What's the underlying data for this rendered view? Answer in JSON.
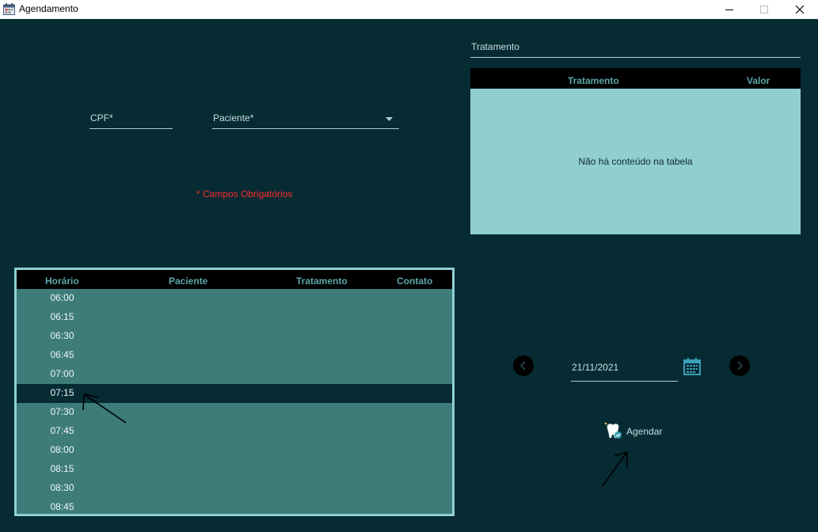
{
  "window": {
    "title": "Agendamento"
  },
  "form": {
    "cpf_label": "CPF*",
    "paciente_label": "Paciente*",
    "required_note": "* Campos Obrigatórios"
  },
  "treatment": {
    "field_label": "Tratamento",
    "columns": [
      "Tratamento",
      "Valor"
    ],
    "empty_message": "Não há conteúdo na tabela"
  },
  "schedule": {
    "columns": [
      "Horário",
      "Paciente",
      "Tratamento",
      "Contato"
    ],
    "rows": [
      {
        "time": "06:00",
        "selected": false
      },
      {
        "time": "06:15",
        "selected": false
      },
      {
        "time": "06:30",
        "selected": false
      },
      {
        "time": "06:45",
        "selected": false
      },
      {
        "time": "07:00",
        "selected": false
      },
      {
        "time": "07:15",
        "selected": true
      },
      {
        "time": "07:30",
        "selected": false
      },
      {
        "time": "07:45",
        "selected": false
      },
      {
        "time": "08:00",
        "selected": false
      },
      {
        "time": "08:15",
        "selected": false
      },
      {
        "time": "08:30",
        "selected": false
      },
      {
        "time": "08:45",
        "selected": false
      }
    ]
  },
  "date_picker": {
    "value": "21/11/2021"
  },
  "actions": {
    "agendar_label": "Agendar"
  },
  "colors": {
    "background": "#062b33",
    "table_header": "#000000",
    "header_text": "#5aa7aa",
    "treatment_body": "#91cfcf",
    "schedule_body": "#3d7c79",
    "schedule_border": "#8ed1d3",
    "required": "#ff2a2a",
    "accent_icon": "#3a9fb6"
  }
}
